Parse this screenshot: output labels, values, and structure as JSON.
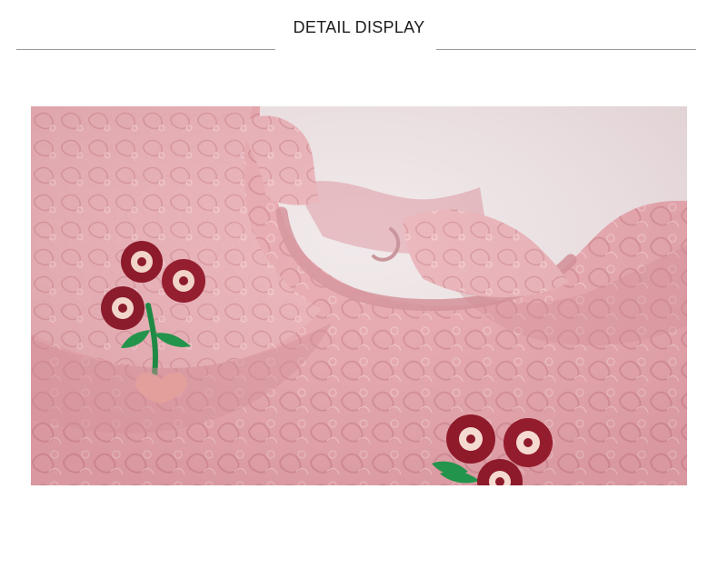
{
  "header": {
    "title": "DETAIL DISPLAY"
  },
  "photo": {
    "subject": "pink-lace-dress-collar-with-embroidered-flowers",
    "colors": {
      "background": "#efe7e8",
      "lace": "#e6a4ab",
      "lace_dark": "#d48c95",
      "lining": "#e7b7bd",
      "flower_red": "#8f1a2a",
      "flower_cream": "#f6d9cf",
      "leaf_green": "#25894a",
      "heart_peach": "#f2b2a0"
    }
  }
}
